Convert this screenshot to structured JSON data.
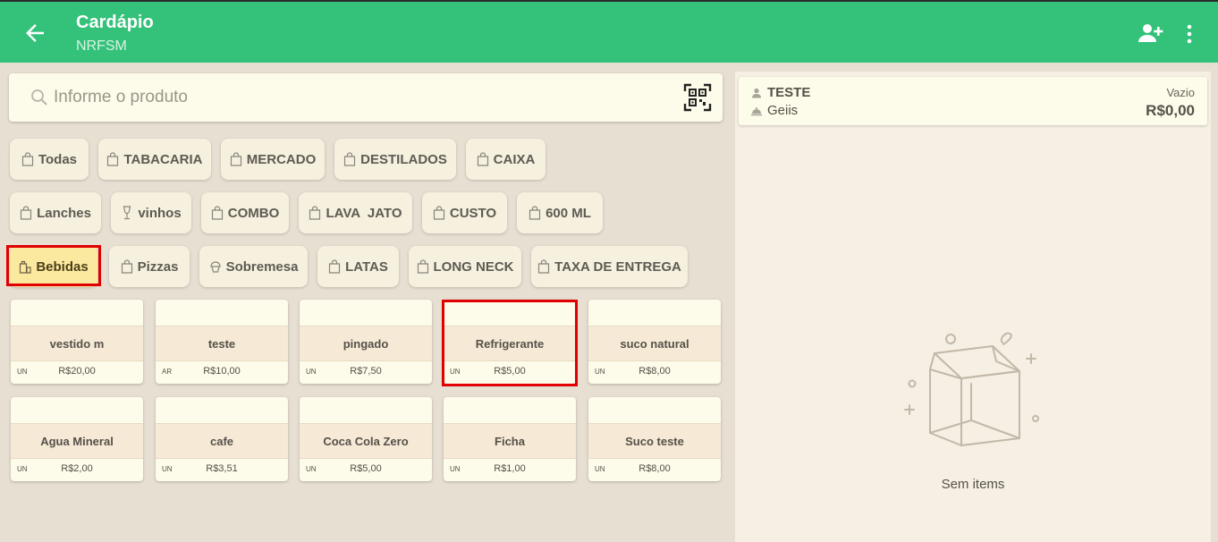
{
  "header": {
    "title": "Cardápio",
    "subtitle": "NRFSM",
    "colors": {
      "bar": "#34c27a"
    },
    "icons": [
      "arrow-back-icon",
      "add-person-icon",
      "more-vert-icon"
    ]
  },
  "search": {
    "placeholder": "Informe o produto"
  },
  "categories": [
    {
      "label": "Todas",
      "icon": "bag-icon"
    },
    {
      "label": "TABACARIA",
      "icon": "bag-icon"
    },
    {
      "label": "MERCADO",
      "icon": "bag-icon"
    },
    {
      "label": "DESTILADOS",
      "icon": "bag-icon"
    },
    {
      "label": "CAIXA",
      "icon": "bag-icon"
    },
    {
      "label": "Lanches",
      "icon": "bag-icon"
    },
    {
      "label": "vinhos",
      "icon": "wine-glass-icon"
    },
    {
      "label": "COMBO",
      "icon": "bag-icon"
    },
    {
      "label": "LAVA  JATO",
      "icon": "bag-icon"
    },
    {
      "label": "CUSTO",
      "icon": "bag-icon"
    },
    {
      "label": "600 ML",
      "icon": "bag-icon"
    },
    {
      "label": "Bebidas",
      "icon": "drinks-icon",
      "selected": true
    },
    {
      "label": "Pizzas",
      "icon": "bag-icon"
    },
    {
      "label": "Sobremesa",
      "icon": "cupcake-icon"
    },
    {
      "label": "LATAS",
      "icon": "bag-icon"
    },
    {
      "label": "LONG NECK",
      "icon": "bag-icon"
    },
    {
      "label": "TAXA DE ENTREGA",
      "icon": "bag-icon"
    }
  ],
  "products": [
    {
      "name": "vestido m",
      "unit": "UN",
      "price": "R$20,00"
    },
    {
      "name": "teste",
      "unit": "AR",
      "price": "R$10,00"
    },
    {
      "name": "pingado",
      "unit": "UN",
      "price": "R$7,50"
    },
    {
      "name": "Refrigerante",
      "unit": "UN",
      "price": "R$5,00"
    },
    {
      "name": "suco natural",
      "unit": "UN",
      "price": "R$8,00"
    },
    {
      "name": "Agua Mineral",
      "unit": "UN",
      "price": "R$2,00"
    },
    {
      "name": "cafe",
      "unit": "UN",
      "price": "R$3,51"
    },
    {
      "name": "Coca Cola Zero",
      "unit": "UN",
      "price": "R$5,00"
    },
    {
      "name": "Ficha",
      "unit": "UN",
      "price": "R$1,00"
    },
    {
      "name": "Suco teste",
      "unit": "UN",
      "price": "R$8,00"
    }
  ],
  "order": {
    "customer": "TESTE",
    "table": "Geiis",
    "status": "Vazio",
    "total": "R$0,00",
    "empty_message": "Sem items",
    "icons": [
      "person-icon",
      "serving-dish-icon",
      "empty-box-icon"
    ]
  },
  "colors": {
    "highlight": "#e00000",
    "selected_chip": "#fbe99f"
  }
}
